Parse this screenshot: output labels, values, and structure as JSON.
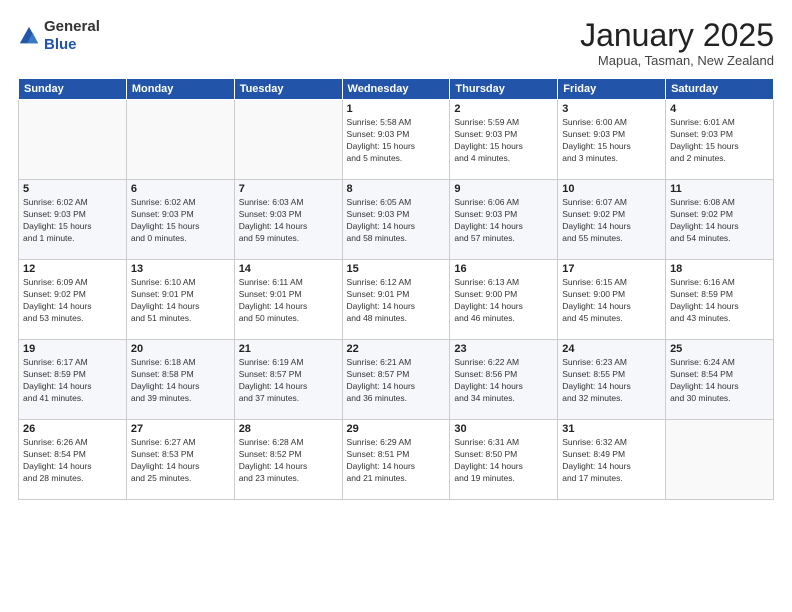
{
  "header": {
    "logo": {
      "line1": "General",
      "line2": "Blue"
    },
    "title": "January 2025",
    "subtitle": "Mapua, Tasman, New Zealand"
  },
  "weekdays": [
    "Sunday",
    "Monday",
    "Tuesday",
    "Wednesday",
    "Thursday",
    "Friday",
    "Saturday"
  ],
  "weeks": [
    [
      {
        "day": "",
        "info": ""
      },
      {
        "day": "",
        "info": ""
      },
      {
        "day": "",
        "info": ""
      },
      {
        "day": "1",
        "info": "Sunrise: 5:58 AM\nSunset: 9:03 PM\nDaylight: 15 hours\nand 5 minutes."
      },
      {
        "day": "2",
        "info": "Sunrise: 5:59 AM\nSunset: 9:03 PM\nDaylight: 15 hours\nand 4 minutes."
      },
      {
        "day": "3",
        "info": "Sunrise: 6:00 AM\nSunset: 9:03 PM\nDaylight: 15 hours\nand 3 minutes."
      },
      {
        "day": "4",
        "info": "Sunrise: 6:01 AM\nSunset: 9:03 PM\nDaylight: 15 hours\nand 2 minutes."
      }
    ],
    [
      {
        "day": "5",
        "info": "Sunrise: 6:02 AM\nSunset: 9:03 PM\nDaylight: 15 hours\nand 1 minute."
      },
      {
        "day": "6",
        "info": "Sunrise: 6:02 AM\nSunset: 9:03 PM\nDaylight: 15 hours\nand 0 minutes."
      },
      {
        "day": "7",
        "info": "Sunrise: 6:03 AM\nSunset: 9:03 PM\nDaylight: 14 hours\nand 59 minutes."
      },
      {
        "day": "8",
        "info": "Sunrise: 6:05 AM\nSunset: 9:03 PM\nDaylight: 14 hours\nand 58 minutes."
      },
      {
        "day": "9",
        "info": "Sunrise: 6:06 AM\nSunset: 9:03 PM\nDaylight: 14 hours\nand 57 minutes."
      },
      {
        "day": "10",
        "info": "Sunrise: 6:07 AM\nSunset: 9:02 PM\nDaylight: 14 hours\nand 55 minutes."
      },
      {
        "day": "11",
        "info": "Sunrise: 6:08 AM\nSunset: 9:02 PM\nDaylight: 14 hours\nand 54 minutes."
      }
    ],
    [
      {
        "day": "12",
        "info": "Sunrise: 6:09 AM\nSunset: 9:02 PM\nDaylight: 14 hours\nand 53 minutes."
      },
      {
        "day": "13",
        "info": "Sunrise: 6:10 AM\nSunset: 9:01 PM\nDaylight: 14 hours\nand 51 minutes."
      },
      {
        "day": "14",
        "info": "Sunrise: 6:11 AM\nSunset: 9:01 PM\nDaylight: 14 hours\nand 50 minutes."
      },
      {
        "day": "15",
        "info": "Sunrise: 6:12 AM\nSunset: 9:01 PM\nDaylight: 14 hours\nand 48 minutes."
      },
      {
        "day": "16",
        "info": "Sunrise: 6:13 AM\nSunset: 9:00 PM\nDaylight: 14 hours\nand 46 minutes."
      },
      {
        "day": "17",
        "info": "Sunrise: 6:15 AM\nSunset: 9:00 PM\nDaylight: 14 hours\nand 45 minutes."
      },
      {
        "day": "18",
        "info": "Sunrise: 6:16 AM\nSunset: 8:59 PM\nDaylight: 14 hours\nand 43 minutes."
      }
    ],
    [
      {
        "day": "19",
        "info": "Sunrise: 6:17 AM\nSunset: 8:59 PM\nDaylight: 14 hours\nand 41 minutes."
      },
      {
        "day": "20",
        "info": "Sunrise: 6:18 AM\nSunset: 8:58 PM\nDaylight: 14 hours\nand 39 minutes."
      },
      {
        "day": "21",
        "info": "Sunrise: 6:19 AM\nSunset: 8:57 PM\nDaylight: 14 hours\nand 37 minutes."
      },
      {
        "day": "22",
        "info": "Sunrise: 6:21 AM\nSunset: 8:57 PM\nDaylight: 14 hours\nand 36 minutes."
      },
      {
        "day": "23",
        "info": "Sunrise: 6:22 AM\nSunset: 8:56 PM\nDaylight: 14 hours\nand 34 minutes."
      },
      {
        "day": "24",
        "info": "Sunrise: 6:23 AM\nSunset: 8:55 PM\nDaylight: 14 hours\nand 32 minutes."
      },
      {
        "day": "25",
        "info": "Sunrise: 6:24 AM\nSunset: 8:54 PM\nDaylight: 14 hours\nand 30 minutes."
      }
    ],
    [
      {
        "day": "26",
        "info": "Sunrise: 6:26 AM\nSunset: 8:54 PM\nDaylight: 14 hours\nand 28 minutes."
      },
      {
        "day": "27",
        "info": "Sunrise: 6:27 AM\nSunset: 8:53 PM\nDaylight: 14 hours\nand 25 minutes."
      },
      {
        "day": "28",
        "info": "Sunrise: 6:28 AM\nSunset: 8:52 PM\nDaylight: 14 hours\nand 23 minutes."
      },
      {
        "day": "29",
        "info": "Sunrise: 6:29 AM\nSunset: 8:51 PM\nDaylight: 14 hours\nand 21 minutes."
      },
      {
        "day": "30",
        "info": "Sunrise: 6:31 AM\nSunset: 8:50 PM\nDaylight: 14 hours\nand 19 minutes."
      },
      {
        "day": "31",
        "info": "Sunrise: 6:32 AM\nSunset: 8:49 PM\nDaylight: 14 hours\nand 17 minutes."
      },
      {
        "day": "",
        "info": ""
      }
    ]
  ]
}
